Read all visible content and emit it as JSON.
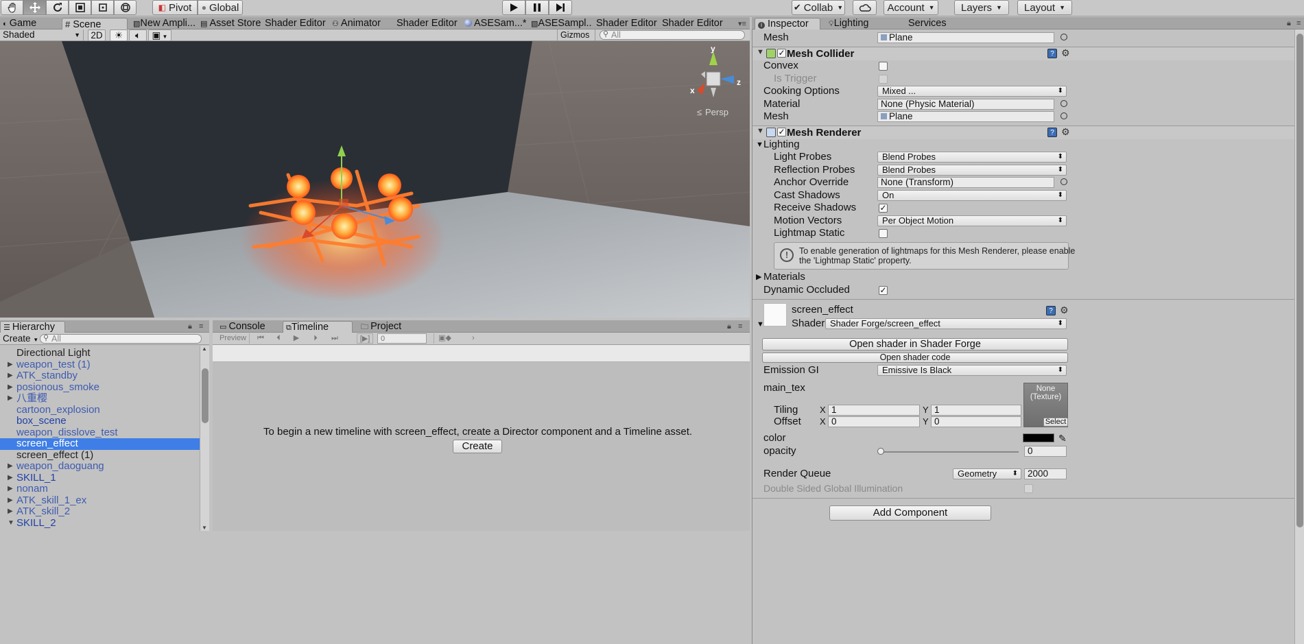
{
  "toolbar": {
    "pivot": "Pivot",
    "global": "Global",
    "collab": "Collab",
    "account": "Account",
    "layers": "Layers",
    "layout": "Layout"
  },
  "top_tabs": [
    {
      "label": "Game",
      "icon": "game-icon"
    },
    {
      "label": "Scene",
      "icon": "scene-icon"
    },
    {
      "label": "New Ampli...",
      "icon": "shader-icon"
    },
    {
      "label": "Asset Store",
      "icon": "store-icon"
    },
    {
      "label": "Shader Editor",
      "icon": ""
    },
    {
      "label": "Animator",
      "icon": "animator-icon"
    },
    {
      "label": "Shader Editor",
      "icon": ""
    },
    {
      "label": "ASESam...*",
      "icon": "sphere-icon"
    },
    {
      "label": "ASESampl...",
      "icon": "shader-icon"
    },
    {
      "label": "Shader Editor",
      "icon": ""
    },
    {
      "label": "Shader Editor",
      "icon": ""
    }
  ],
  "scene_toolbar": {
    "shading": "Shaded",
    "mode_2d": "2D",
    "gizmos": "Gizmos",
    "search_placeholder": "All"
  },
  "scene": {
    "persp_label": "Persp",
    "axis_y": "y",
    "axis_x": "x",
    "axis_z": "z"
  },
  "inspector_tabs": [
    {
      "label": "Inspector",
      "icon": "info-icon"
    },
    {
      "label": "Lighting",
      "icon": "lighting-icon"
    },
    {
      "label": "Services",
      "icon": ""
    }
  ],
  "inspector": {
    "mesh_filter": {
      "mesh_label": "Mesh",
      "mesh_value": "Plane"
    },
    "mesh_collider": {
      "title": "Mesh Collider",
      "convex": "Convex",
      "is_trigger": "Is Trigger",
      "cooking_options": "Cooking Options",
      "cooking_value": "Mixed ...",
      "material": "Material",
      "material_value": "None (Physic Material)",
      "mesh": "Mesh",
      "mesh_value": "Plane"
    },
    "mesh_renderer": {
      "title": "Mesh Renderer",
      "lighting": "Lighting",
      "light_probes": "Light Probes",
      "light_probes_value": "Blend Probes",
      "reflection_probes": "Reflection Probes",
      "reflection_probes_value": "Blend Probes",
      "anchor_override": "Anchor Override",
      "anchor_override_value": "None (Transform)",
      "cast_shadows": "Cast Shadows",
      "cast_shadows_value": "On",
      "receive_shadows": "Receive Shadows",
      "motion_vectors": "Motion Vectors",
      "motion_vectors_value": "Per Object Motion",
      "lightmap_static": "Lightmap Static",
      "info_line1": "To enable generation of lightmaps for this Mesh Renderer, please enable",
      "info_line2": "the 'Lightmap Static' property.",
      "materials": "Materials",
      "dynamic_occluded": "Dynamic Occluded"
    },
    "material": {
      "name": "screen_effect",
      "shader_label": "Shader",
      "shader_value": "Shader Forge/screen_effect",
      "open_shader_forge": "Open shader in Shader Forge",
      "open_shader_code": "Open shader code",
      "emission_gi": "Emission GI",
      "emission_gi_value": "Emissive Is Black",
      "main_tex": "main_tex",
      "texture_none": "None",
      "texture_type": "(Texture)",
      "select": "Select",
      "tiling": "Tiling",
      "offset": "Offset",
      "x": "X",
      "y": "Y",
      "tiling_x": "1",
      "tiling_y": "1",
      "offset_x": "0",
      "offset_y": "0",
      "color": "color",
      "color_value": "#000000",
      "opacity": "opacity",
      "opacity_value": "0",
      "render_queue": "Render Queue",
      "render_queue_mode": "Geometry",
      "render_queue_value": "2000",
      "double_sided_gi": "Double Sided Global Illumination"
    },
    "add_component": "Add Component"
  },
  "hierarchy": {
    "tab": "Hierarchy",
    "create": "Create",
    "search_placeholder": "All",
    "items": [
      {
        "label": "Directional Light",
        "style": "normal",
        "arrow": ""
      },
      {
        "label": "weapon_test (1)",
        "style": "dprefab",
        "arrow": "▶"
      },
      {
        "label": "ATK_standby",
        "style": "dprefab",
        "arrow": "▶"
      },
      {
        "label": "posionous_smoke",
        "style": "dprefab",
        "arrow": "▶"
      },
      {
        "label": "八重樱",
        "style": "dprefab",
        "arrow": "▶"
      },
      {
        "label": "cartoon_explosion",
        "style": "dprefab",
        "arrow": ""
      },
      {
        "label": "box_scene",
        "style": "prefab",
        "arrow": ""
      },
      {
        "label": "weapon_disslove_test",
        "style": "dprefab",
        "arrow": ""
      },
      {
        "label": "screen_effect",
        "style": "selected",
        "arrow": ""
      },
      {
        "label": "screen_effect (1)",
        "style": "normal",
        "arrow": ""
      },
      {
        "label": "weapon_daoguang",
        "style": "dprefab",
        "arrow": "▶"
      },
      {
        "label": "SKILL_1",
        "style": "prefab",
        "arrow": "▶"
      },
      {
        "label": "nonam",
        "style": "dprefab",
        "arrow": "▶"
      },
      {
        "label": "ATK_skill_1_ex",
        "style": "dprefab",
        "arrow": "▶"
      },
      {
        "label": "ATK_skill_2",
        "style": "dprefab",
        "arrow": "▶"
      },
      {
        "label": "SKILL_2",
        "style": "prefab",
        "arrow": "▼"
      }
    ]
  },
  "bottom_tabs": [
    {
      "label": "Console",
      "icon": "console-icon"
    },
    {
      "label": "Timeline",
      "icon": "timeline-icon"
    },
    {
      "label": "Project",
      "icon": "folder-icon"
    }
  ],
  "timeline": {
    "preview": "Preview",
    "frame": "0",
    "message": "To begin a new timeline with screen_effect, create a Director component and a Timeline asset.",
    "create_button": "Create"
  }
}
